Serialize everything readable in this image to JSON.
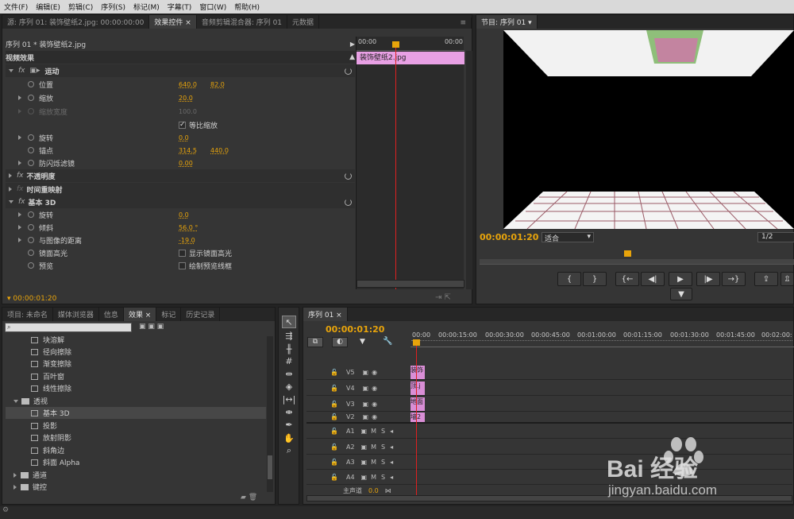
{
  "menubar": [
    "文件(F)",
    "编辑(E)",
    "剪辑(C)",
    "序列(S)",
    "标记(M)",
    "字幕(T)",
    "窗口(W)",
    "帮助(H)"
  ],
  "source_panel": {
    "tabs": [
      "源: 序列 01: 装饰壁纸2.jpg: 00:00:00:00",
      "效果控件 ×",
      "音频剪辑混合器: 序列 01",
      "元数据"
    ]
  },
  "effect_controls": {
    "clip_name": "序列 01 * 装饰壁纸2.jpg",
    "section": "视频效果",
    "timeline_start": "00:00",
    "timeline_end": "00:00",
    "clip_bar_label": "装饰壁纸2.jpg",
    "motion": {
      "label": "运动",
      "position_label": "位置",
      "position_x": "640.0",
      "position_y": "82.0",
      "scale_label": "缩放",
      "scale": "20.0",
      "scale_width_label": "缩放宽度",
      "scale_width": "100.0",
      "uniform_label": "等比缩放",
      "rotation_label": "旋转",
      "rotation": "0.0",
      "anchor_label": "锚点",
      "anchor_x": "314.5",
      "anchor_y": "440.0",
      "flicker_label": "防闪烁滤镜",
      "flicker": "0.00"
    },
    "opacity_label": "不透明度",
    "time_remap_label": "时间重映射",
    "basic3d": {
      "label": "基本 3D",
      "swivel_label": "旋转",
      "swivel": "0.0",
      "tilt_label": "倾斜",
      "tilt": "56.0 °",
      "distance_label": "与图像的距离",
      "distance": "-19.0",
      "specular_label": "镜面高光",
      "specular_check": "显示镜面高光",
      "preview_label": "预览",
      "preview_check": "绘制预览线框"
    },
    "current_time": "00:00:01:20"
  },
  "program": {
    "tab": "节目: 序列 01",
    "timecode": "00:00:01:20",
    "fit": "适合",
    "resolution": "1/2"
  },
  "project_panel": {
    "tabs": [
      "项目: 未命名",
      "媒体浏览器",
      "信息",
      "效果 ×",
      "标记",
      "历史记录"
    ],
    "items": [
      "块溶解",
      "径向擦除",
      "渐变擦除",
      "百叶窗",
      "线性擦除"
    ],
    "folder": "透视",
    "sub_items": [
      "基本 3D",
      "投影",
      "放射阴影",
      "斜角边",
      "斜面 Alpha"
    ],
    "folders_after": [
      "通道",
      "键控"
    ]
  },
  "timeline": {
    "tab": "序列 01 ×",
    "timecode": "00:00:01:20",
    "ruler": [
      "00:00",
      "00:00:15:00",
      "00:00:30:00",
      "00:00:45:00",
      "00:01:00:00",
      "00:01:15:00",
      "00:01:30:00",
      "00:01:45:00",
      "00:02:00:"
    ],
    "video_tracks": [
      "V5",
      "V4",
      "V3",
      "V2"
    ],
    "audio_tracks": [
      "A1",
      "A2",
      "A3",
      "A4"
    ],
    "master": "主声道",
    "master_val": "0.0",
    "clips": [
      "装饰",
      "顶.j",
      "地面",
      "墙2"
    ]
  },
  "watermark": {
    "brand": "Bai 经验",
    "url": "jingyan.baidu.com"
  }
}
